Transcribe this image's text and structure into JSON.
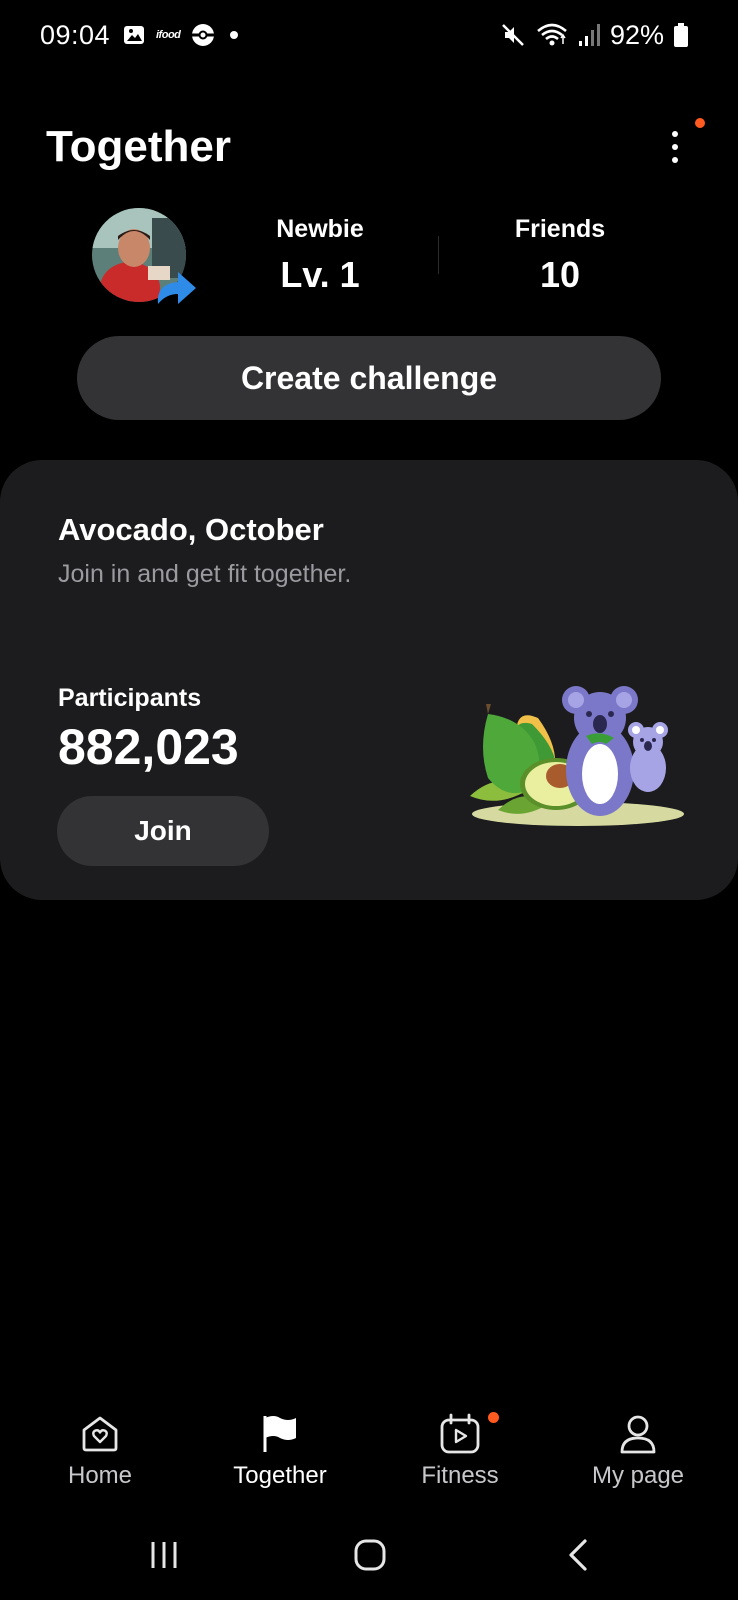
{
  "status_bar": {
    "time": "09:04",
    "notif_icons": [
      "image-icon",
      "ifood-icon",
      "pokeball-icon",
      "dot-icon"
    ],
    "ifood_text": "ifood",
    "system_icons": [
      "mute-icon",
      "wifi-icon",
      "signal-icon",
      "battery-icon"
    ],
    "battery": "92%"
  },
  "header": {
    "title": "Together",
    "menu_has_badge": true
  },
  "profile": {
    "level_label": "Newbie",
    "level_value": "Lv. 1",
    "friends_label": "Friends",
    "friends_value": "10"
  },
  "actions": {
    "create_challenge": "Create challenge"
  },
  "challenge": {
    "title": "Avocado, October",
    "subtitle": "Join in and get fit together.",
    "participants_label": "Participants",
    "participants_value": "882,023",
    "join_label": "Join"
  },
  "bottom_nav": {
    "items": [
      {
        "label": "Home",
        "icon": "home-heart-icon",
        "active": false
      },
      {
        "label": "Together",
        "icon": "flag-icon",
        "active": true
      },
      {
        "label": "Fitness",
        "icon": "fitness-calendar-icon",
        "active": false,
        "badge": true
      },
      {
        "label": "My page",
        "icon": "person-icon",
        "active": false
      }
    ]
  },
  "system_nav": [
    "recents-icon",
    "home-icon",
    "back-icon"
  ],
  "colors": {
    "background": "#000000",
    "card": "#1c1c1e",
    "button": "#333336",
    "badge": "#ff5a1f",
    "muted_text": "#9a9a9f"
  }
}
